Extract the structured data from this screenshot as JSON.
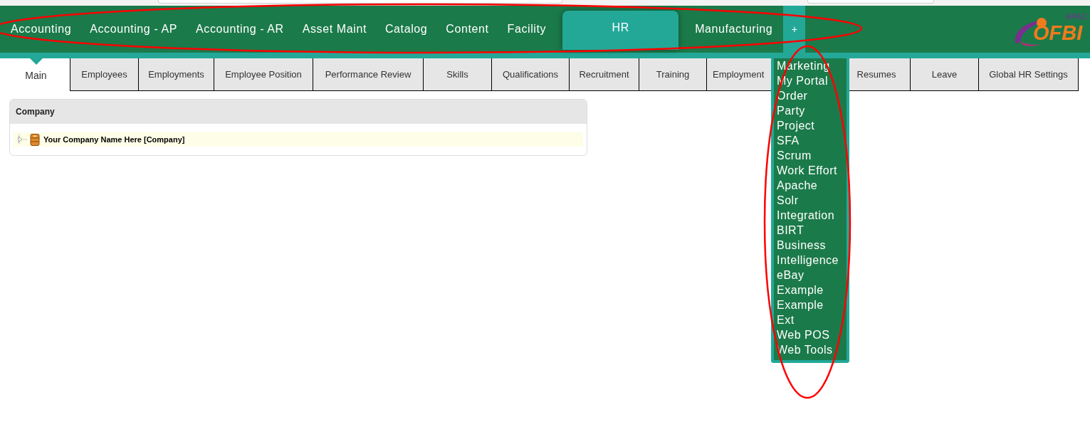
{
  "app_tabs": [
    {
      "label": "Accounting",
      "selected": false
    },
    {
      "label": "Accounting - AP",
      "selected": false
    },
    {
      "label": "Accounting - AR",
      "selected": false
    },
    {
      "label": "Asset Maint",
      "selected": false
    },
    {
      "label": "Catalog",
      "selected": false
    },
    {
      "label": "Content",
      "selected": false
    },
    {
      "label": "Facility",
      "selected": false
    },
    {
      "label": "HR",
      "selected": true
    },
    {
      "label": "Manufacturing",
      "selected": false
    }
  ],
  "more_tab": {
    "label": "+",
    "expanded": true
  },
  "logo": {
    "top": "APAC",
    "main": "OFBI"
  },
  "sub_tabs": [
    {
      "label": "Main",
      "selected": true
    },
    {
      "label": "Employees",
      "selected": false
    },
    {
      "label": "Employments",
      "selected": false
    },
    {
      "label": "Employee Position",
      "selected": false
    },
    {
      "label": "Performance Review",
      "selected": false
    },
    {
      "label": "Skills",
      "selected": false
    },
    {
      "label": "Qualifications",
      "selected": false
    },
    {
      "label": "Recruitment",
      "selected": false
    },
    {
      "label": "Training",
      "selected": false
    },
    {
      "label": "Employment",
      "selected": false
    },
    {
      "label": "Resumes",
      "selected": false
    },
    {
      "label": "Leave",
      "selected": false
    },
    {
      "label": "Global HR Settings",
      "selected": false
    }
  ],
  "panel": {
    "title": "Company",
    "tree": [
      {
        "label": "Your Company Name Here [Company]",
        "expanded": false
      }
    ]
  },
  "more_menu": [
    "Marketing",
    "My Portal",
    "Order",
    "Party",
    "Project",
    "SFA",
    "Scrum",
    "Work Effort",
    "Apache Solr Integration",
    "BIRT",
    "Business Intelligence",
    "eBay",
    "Example",
    "Example Ext",
    "Web POS",
    "Web Tools"
  ],
  "annotations": [
    {
      "kind": "ellipse",
      "color": "#ff0000"
    },
    {
      "kind": "ellipse",
      "color": "#ff0000"
    }
  ]
}
